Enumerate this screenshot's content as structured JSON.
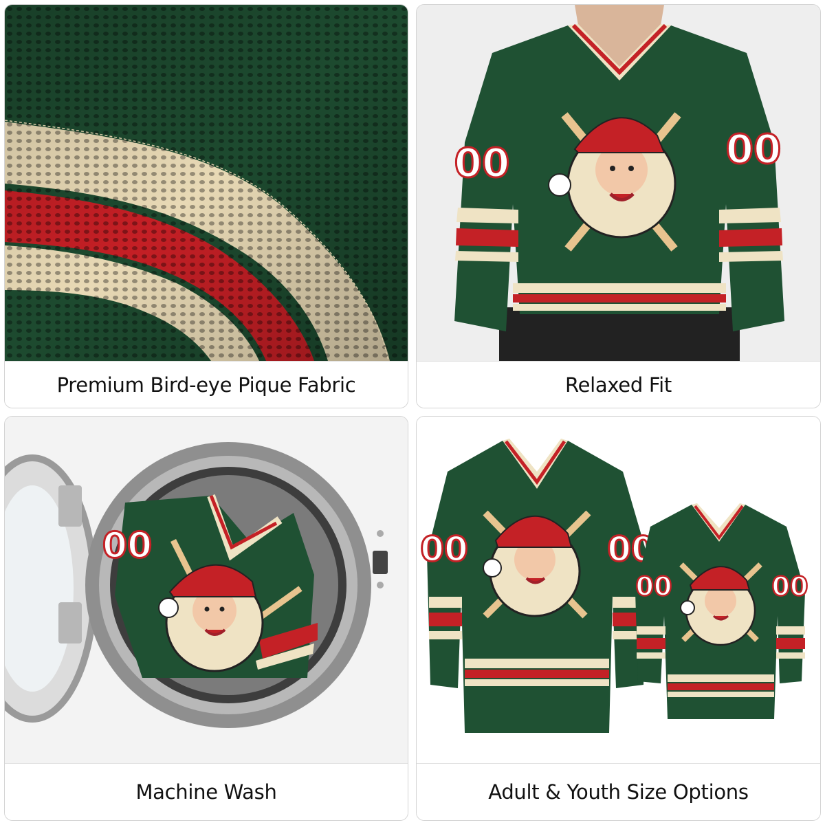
{
  "panels": [
    {
      "caption": "Premium Bird-eye Pique Fabric",
      "image": "fabric-closeup-photo"
    },
    {
      "caption": "Relaxed Fit",
      "image": "worn-jersey-photo"
    },
    {
      "caption": "Machine Wash",
      "image": "washing-machine-photo"
    },
    {
      "caption": "Adult & Youth Size Options",
      "image": "adult-youth-jersey-photo"
    }
  ],
  "jersey": {
    "number": "00",
    "colors": {
      "green": "#1f5133",
      "cream": "#efe3c4",
      "red": "#c42126"
    }
  }
}
